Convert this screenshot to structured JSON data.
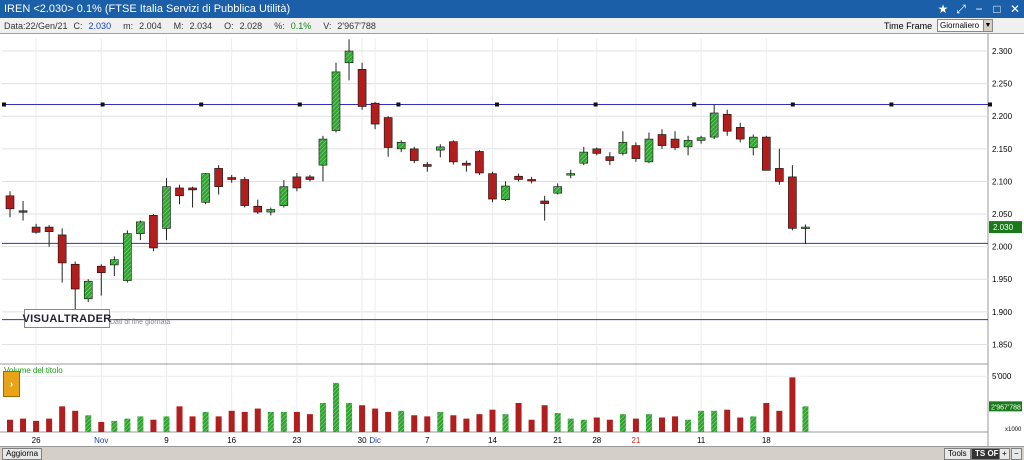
{
  "window": {
    "title": "IREN <2.030> 0.1%  (FTSE Italia Servizi di Pubblica Utilità)",
    "controls": [
      "★",
      "⤢",
      "−",
      "□",
      "✕"
    ]
  },
  "info": {
    "date_label": "Data:22/Gen/21",
    "close_label": "C:",
    "close": "2.030",
    "min_label": "m:",
    "min": "2.004",
    "max_label": "M:",
    "max": "2.034",
    "open_label": "O:",
    "open": "2.028",
    "pct_label": "%:",
    "pct": "0.1%",
    "vol_label": "V:",
    "volume": "2'967'788"
  },
  "timeframe": {
    "label": "Time Frame",
    "value": "Giornaliero"
  },
  "logo": {
    "text": "VISUALTRADER",
    "subtitle": "Dati di fine giornata"
  },
  "volume_panel": {
    "title": "Volume del titolo",
    "tick": "5'000",
    "multiplier": "x1000",
    "last_label": "2'967'788"
  },
  "bottom": {
    "aggiorna": "Aggiorna",
    "tools": "Tools",
    "ts_off": "TS OFF",
    "plus": "+",
    "minus": "−"
  },
  "colors": {
    "up": "#2fa52f",
    "down": "#b01e1e",
    "hline": "#3030c0",
    "axis_label_bg": "#1a7a1a"
  },
  "chart_data": {
    "type": "candlestick",
    "symbol": "IREN",
    "ylim": [
      1.82,
      2.32
    ],
    "y_ticks": [
      1.85,
      1.9,
      1.95,
      2.0,
      2.05,
      2.1,
      2.15,
      2.2,
      2.25,
      2.3
    ],
    "y_tick_labels": [
      "1.850",
      "1.900",
      "1.950",
      "2.000",
      "2.050",
      "2.100",
      "2.150",
      "2.200",
      "2.250",
      "2.300"
    ],
    "last_price_label": "2.030",
    "horizontal_lines": [
      2.218,
      2.005,
      1.888
    ],
    "x_labels": [
      {
        "text": "26",
        "index": 2,
        "color": "#000"
      },
      {
        "text": "Nov",
        "index": 7,
        "color": "#1a3fb0"
      },
      {
        "text": "9",
        "index": 12,
        "color": "#000"
      },
      {
        "text": "16",
        "index": 17,
        "color": "#000"
      },
      {
        "text": "23",
        "index": 22,
        "color": "#000"
      },
      {
        "text": "30",
        "index": 27,
        "color": "#000"
      },
      {
        "text": "Dic",
        "index": 28,
        "color": "#1a3fb0"
      },
      {
        "text": "7",
        "index": 32,
        "color": "#000"
      },
      {
        "text": "14",
        "index": 37,
        "color": "#000"
      },
      {
        "text": "21",
        "index": 42,
        "color": "#000"
      },
      {
        "text": "28",
        "index": 45,
        "color": "#000"
      },
      {
        "text": "21",
        "index": 48,
        "color": "#d02020"
      },
      {
        "text": "11",
        "index": 53,
        "color": "#000"
      },
      {
        "text": "18",
        "index": 58,
        "color": "#000"
      }
    ],
    "candles": [
      {
        "o": 2.078,
        "h": 2.085,
        "l": 2.045,
        "c": 2.058
      },
      {
        "o": 2.055,
        "h": 2.07,
        "l": 2.04,
        "c": 2.053
      },
      {
        "o": 2.03,
        "h": 2.035,
        "l": 2.02,
        "c": 2.022
      },
      {
        "o": 2.03,
        "h": 2.033,
        "l": 2.0,
        "c": 2.023
      },
      {
        "o": 2.018,
        "h": 2.028,
        "l": 1.945,
        "c": 1.975
      },
      {
        "o": 1.973,
        "h": 1.977,
        "l": 1.88,
        "c": 1.935
      },
      {
        "o": 1.92,
        "h": 1.95,
        "l": 1.915,
        "c": 1.947
      },
      {
        "o": 1.97,
        "h": 1.973,
        "l": 1.925,
        "c": 1.96
      },
      {
        "o": 1.972,
        "h": 1.985,
        "l": 1.955,
        "c": 1.98
      },
      {
        "o": 1.948,
        "h": 2.025,
        "l": 1.945,
        "c": 2.02
      },
      {
        "o": 2.02,
        "h": 2.04,
        "l": 2.01,
        "c": 2.038
      },
      {
        "o": 2.048,
        "h": 2.05,
        "l": 1.993,
        "c": 1.998
      },
      {
        "o": 2.028,
        "h": 2.105,
        "l": 2.01,
        "c": 2.092
      },
      {
        "o": 2.09,
        "h": 2.095,
        "l": 2.065,
        "c": 2.078
      },
      {
        "o": 2.09,
        "h": 2.092,
        "l": 2.06,
        "c": 2.087
      },
      {
        "o": 2.068,
        "h": 2.113,
        "l": 2.065,
        "c": 2.112
      },
      {
        "o": 2.12,
        "h": 2.125,
        "l": 2.08,
        "c": 2.092
      },
      {
        "o": 2.106,
        "h": 2.11,
        "l": 2.098,
        "c": 2.103
      },
      {
        "o": 2.103,
        "h": 2.107,
        "l": 2.06,
        "c": 2.063
      },
      {
        "o": 2.062,
        "h": 2.072,
        "l": 2.05,
        "c": 2.053
      },
      {
        "o": 2.053,
        "h": 2.06,
        "l": 2.048,
        "c": 2.057
      },
      {
        "o": 2.063,
        "h": 2.102,
        "l": 2.06,
        "c": 2.092
      },
      {
        "o": 2.107,
        "h": 2.113,
        "l": 2.085,
        "c": 2.09
      },
      {
        "o": 2.107,
        "h": 2.11,
        "l": 2.1,
        "c": 2.103
      },
      {
        "o": 2.125,
        "h": 2.17,
        "l": 2.1,
        "c": 2.165
      },
      {
        "o": 2.178,
        "h": 2.282,
        "l": 2.175,
        "c": 2.268
      },
      {
        "o": 2.282,
        "h": 2.318,
        "l": 2.255,
        "c": 2.3
      },
      {
        "o": 2.272,
        "h": 2.282,
        "l": 2.21,
        "c": 2.215
      },
      {
        "o": 2.22,
        "h": 2.222,
        "l": 2.18,
        "c": 2.188
      },
      {
        "o": 2.198,
        "h": 2.2,
        "l": 2.138,
        "c": 2.152
      },
      {
        "o": 2.15,
        "h": 2.163,
        "l": 2.145,
        "c": 2.16
      },
      {
        "o": 2.15,
        "h": 2.153,
        "l": 2.128,
        "c": 2.132
      },
      {
        "o": 2.126,
        "h": 2.13,
        "l": 2.115,
        "c": 2.123
      },
      {
        "o": 2.148,
        "h": 2.157,
        "l": 2.137,
        "c": 2.153
      },
      {
        "o": 2.161,
        "h": 2.163,
        "l": 2.126,
        "c": 2.13
      },
      {
        "o": 2.128,
        "h": 2.132,
        "l": 2.115,
        "c": 2.125
      },
      {
        "o": 2.146,
        "h": 2.148,
        "l": 2.11,
        "c": 2.113
      },
      {
        "o": 2.112,
        "h": 2.115,
        "l": 2.068,
        "c": 2.073
      },
      {
        "o": 2.072,
        "h": 2.1,
        "l": 2.07,
        "c": 2.093
      },
      {
        "o": 2.108,
        "h": 2.112,
        "l": 2.1,
        "c": 2.103
      },
      {
        "o": 2.103,
        "h": 2.107,
        "l": 2.097,
        "c": 2.102
      },
      {
        "o": 2.07,
        "h": 2.078,
        "l": 2.04,
        "c": 2.066
      },
      {
        "o": 2.082,
        "h": 2.097,
        "l": 2.08,
        "c": 2.092
      },
      {
        "o": 2.11,
        "h": 2.118,
        "l": 2.105,
        "c": 2.112
      },
      {
        "o": 2.128,
        "h": 2.153,
        "l": 2.125,
        "c": 2.145
      },
      {
        "o": 2.15,
        "h": 2.152,
        "l": 2.14,
        "c": 2.143
      },
      {
        "o": 2.138,
        "h": 2.145,
        "l": 2.125,
        "c": 2.132
      },
      {
        "o": 2.143,
        "h": 2.177,
        "l": 2.14,
        "c": 2.16
      },
      {
        "o": 2.155,
        "h": 2.16,
        "l": 2.13,
        "c": 2.135
      },
      {
        "o": 2.13,
        "h": 2.175,
        "l": 2.128,
        "c": 2.165
      },
      {
        "o": 2.172,
        "h": 2.18,
        "l": 2.15,
        "c": 2.155
      },
      {
        "o": 2.165,
        "h": 2.177,
        "l": 2.148,
        "c": 2.152
      },
      {
        "o": 2.153,
        "h": 2.17,
        "l": 2.14,
        "c": 2.163
      },
      {
        "o": 2.163,
        "h": 2.17,
        "l": 2.158,
        "c": 2.167
      },
      {
        "o": 2.168,
        "h": 2.218,
        "l": 2.165,
        "c": 2.205
      },
      {
        "o": 2.203,
        "h": 2.21,
        "l": 2.17,
        "c": 2.177
      },
      {
        "o": 2.183,
        "h": 2.19,
        "l": 2.16,
        "c": 2.165
      },
      {
        "o": 2.152,
        "h": 2.172,
        "l": 2.14,
        "c": 2.168
      },
      {
        "o": 2.168,
        "h": 2.17,
        "l": 2.13,
        "c": 2.117
      },
      {
        "o": 2.12,
        "h": 2.15,
        "l": 2.095,
        "c": 2.1
      },
      {
        "o": 2.107,
        "h": 2.125,
        "l": 2.025,
        "c": 2.028
      },
      {
        "o": 2.028,
        "h": 2.034,
        "l": 2.004,
        "c": 2.03
      }
    ],
    "volumes": [
      1.1,
      1.2,
      1.0,
      1.2,
      2.3,
      1.9,
      1.5,
      0.9,
      1.0,
      1.2,
      1.4,
      1.1,
      1.4,
      2.3,
      1.4,
      1.8,
      1.4,
      1.9,
      1.8,
      2.1,
      1.8,
      1.8,
      1.8,
      1.6,
      2.6,
      4.4,
      2.6,
      2.4,
      2.1,
      1.8,
      1.9,
      1.5,
      1.4,
      1.8,
      1.5,
      1.2,
      1.6,
      2.0,
      1.6,
      2.6,
      1.1,
      2.4,
      1.7,
      1.2,
      1.1,
      1.3,
      1.1,
      1.6,
      1.2,
      1.6,
      1.3,
      1.4,
      1.1,
      1.9,
      1.9,
      2.0,
      1.3,
      1.4,
      2.6,
      1.9,
      4.9,
      2.3
    ]
  }
}
